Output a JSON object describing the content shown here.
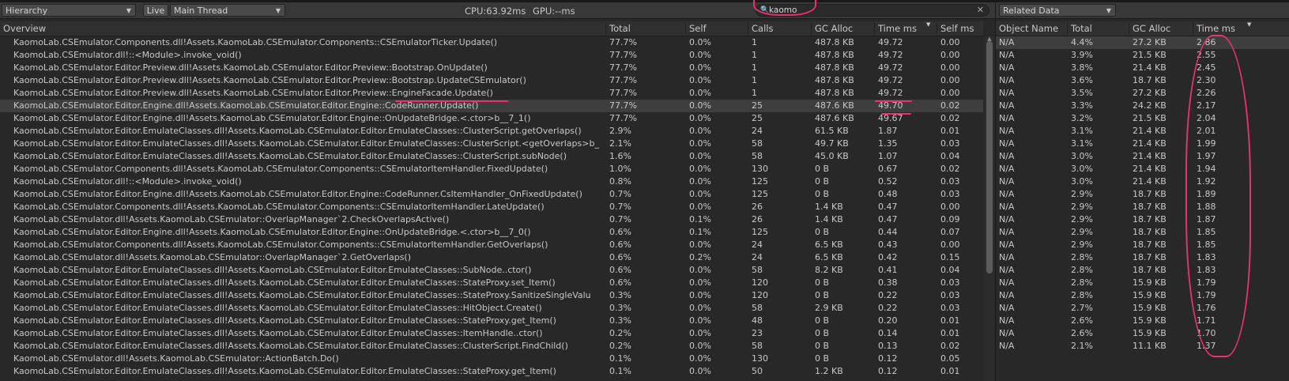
{
  "toolbar": {
    "view_mode": "Hierarchy",
    "live_label": "Live",
    "thread": "Main Thread",
    "cpu": "CPU:63.92ms",
    "gpu": "GPU:--ms",
    "search_value": "kaomo"
  },
  "columns": [
    "Overview",
    "Total",
    "Self",
    "Calls",
    "GC Alloc",
    "Time ms",
    "Self ms"
  ],
  "rows": [
    {
      "name": "KaomoLab.CSEmulator.Components.dll!Assets.KaomoLab.CSEmulator.Components::CSEmulatorTicker.Update()",
      "total": "77.7%",
      "self": "0.0%",
      "calls": "1",
      "gc": "487.8 KB",
      "time": "49.72",
      "selfms": "0.00"
    },
    {
      "name": "KaomoLab.CSEmulator.dll!::<Module>.invoke_void()",
      "total": "77.7%",
      "self": "0.0%",
      "calls": "1",
      "gc": "487.8 KB",
      "time": "49.72",
      "selfms": "0.00"
    },
    {
      "name": "KaomoLab.CSEmulator.Editor.Preview.dll!Assets.KaomoLab.CSEmulator.Editor.Preview::Bootstrap.OnUpdate()",
      "total": "77.7%",
      "self": "0.0%",
      "calls": "1",
      "gc": "487.8 KB",
      "time": "49.72",
      "selfms": "0.00"
    },
    {
      "name": "KaomoLab.CSEmulator.Editor.Preview.dll!Assets.KaomoLab.CSEmulator.Editor.Preview::Bootstrap.UpdateCSEmulator()",
      "total": "77.7%",
      "self": "0.0%",
      "calls": "1",
      "gc": "487.8 KB",
      "time": "49.72",
      "selfms": "0.00"
    },
    {
      "name": "KaomoLab.CSEmulator.Editor.Preview.dll!Assets.KaomoLab.CSEmulator.Editor.Preview::EngineFacade.Update()",
      "total": "77.7%",
      "self": "0.0%",
      "calls": "1",
      "gc": "487.8 KB",
      "time": "49.72",
      "selfms": "0.00"
    },
    {
      "name": "KaomoLab.CSEmulator.Editor.Engine.dll!Assets.KaomoLab.CSEmulator.Editor.Engine::CodeRunner.Update()",
      "total": "77.7%",
      "self": "0.0%",
      "calls": "25",
      "gc": "487.6 KB",
      "time": "49.70",
      "selfms": "0.02"
    },
    {
      "name": "KaomoLab.CSEmulator.Editor.Engine.dll!Assets.KaomoLab.CSEmulator.Editor.Engine::OnUpdateBridge.<.ctor>b__7_1()",
      "total": "77.7%",
      "self": "0.0%",
      "calls": "25",
      "gc": "487.6 KB",
      "time": "49.67",
      "selfms": "0.02"
    },
    {
      "name": "KaomoLab.CSEmulator.Editor.EmulateClasses.dll!Assets.KaomoLab.CSEmulator.Editor.EmulateClasses::ClusterScript.getOverlaps()",
      "total": "2.9%",
      "self": "0.0%",
      "calls": "24",
      "gc": "61.5 KB",
      "time": "1.87",
      "selfms": "0.01"
    },
    {
      "name": "KaomoLab.CSEmulator.Editor.EmulateClasses.dll!Assets.KaomoLab.CSEmulator.Editor.EmulateClasses::ClusterScript.<getOverlaps>b_",
      "total": "2.1%",
      "self": "0.0%",
      "calls": "58",
      "gc": "49.7 KB",
      "time": "1.35",
      "selfms": "0.03"
    },
    {
      "name": "KaomoLab.CSEmulator.Editor.EmulateClasses.dll!Assets.KaomoLab.CSEmulator.Editor.EmulateClasses::ClusterScript.subNode()",
      "total": "1.6%",
      "self": "0.0%",
      "calls": "58",
      "gc": "45.0 KB",
      "time": "1.07",
      "selfms": "0.04"
    },
    {
      "name": "KaomoLab.CSEmulator.Components.dll!Assets.KaomoLab.CSEmulator.Components::CSEmulatorItemHandler.FixedUpdate()",
      "total": "1.0%",
      "self": "0.0%",
      "calls": "130",
      "gc": "0 B",
      "time": "0.67",
      "selfms": "0.02"
    },
    {
      "name": "KaomoLab.CSEmulator.dll!::<Module>.invoke_void()",
      "total": "0.8%",
      "self": "0.0%",
      "calls": "125",
      "gc": "0 B",
      "time": "0.52",
      "selfms": "0.03"
    },
    {
      "name": "KaomoLab.CSEmulator.Editor.Engine.dll!Assets.KaomoLab.CSEmulator.Editor.Engine::CodeRunner.CsItemHandler_OnFixedUpdate()",
      "total": "0.7%",
      "self": "0.0%",
      "calls": "125",
      "gc": "0 B",
      "time": "0.48",
      "selfms": "0.03"
    },
    {
      "name": "KaomoLab.CSEmulator.Components.dll!Assets.KaomoLab.CSEmulator.Components::CSEmulatorItemHandler.LateUpdate()",
      "total": "0.7%",
      "self": "0.0%",
      "calls": "26",
      "gc": "1.4 KB",
      "time": "0.47",
      "selfms": "0.00"
    },
    {
      "name": "KaomoLab.CSEmulator.dll!Assets.KaomoLab.CSEmulator::OverlapManager`2.CheckOverlapsActive()",
      "total": "0.7%",
      "self": "0.1%",
      "calls": "26",
      "gc": "1.4 KB",
      "time": "0.47",
      "selfms": "0.09"
    },
    {
      "name": "KaomoLab.CSEmulator.Editor.Engine.dll!Assets.KaomoLab.CSEmulator.Editor.Engine::OnUpdateBridge.<.ctor>b__7_0()",
      "total": "0.6%",
      "self": "0.1%",
      "calls": "125",
      "gc": "0 B",
      "time": "0.44",
      "selfms": "0.07"
    },
    {
      "name": "KaomoLab.CSEmulator.Components.dll!Assets.KaomoLab.CSEmulator.Components::CSEmulatorItemHandler.GetOverlaps()",
      "total": "0.6%",
      "self": "0.0%",
      "calls": "24",
      "gc": "6.5 KB",
      "time": "0.43",
      "selfms": "0.00"
    },
    {
      "name": "KaomoLab.CSEmulator.dll!Assets.KaomoLab.CSEmulator::OverlapManager`2.GetOverlaps()",
      "total": "0.6%",
      "self": "0.2%",
      "calls": "24",
      "gc": "6.5 KB",
      "time": "0.42",
      "selfms": "0.15"
    },
    {
      "name": "KaomoLab.CSEmulator.Editor.EmulateClasses.dll!Assets.KaomoLab.CSEmulator.Editor.EmulateClasses::SubNode..ctor()",
      "total": "0.6%",
      "self": "0.0%",
      "calls": "58",
      "gc": "8.2 KB",
      "time": "0.41",
      "selfms": "0.04"
    },
    {
      "name": "KaomoLab.CSEmulator.Editor.EmulateClasses.dll!Assets.KaomoLab.CSEmulator.Editor.EmulateClasses::StateProxy.set_Item()",
      "total": "0.6%",
      "self": "0.0%",
      "calls": "120",
      "gc": "0 B",
      "time": "0.38",
      "selfms": "0.03"
    },
    {
      "name": "KaomoLab.CSEmulator.Editor.EmulateClasses.dll!Assets.KaomoLab.CSEmulator.Editor.EmulateClasses::StateProxy.SanitizeSingleValu",
      "total": "0.3%",
      "self": "0.0%",
      "calls": "120",
      "gc": "0 B",
      "time": "0.22",
      "selfms": "0.03"
    },
    {
      "name": "KaomoLab.CSEmulator.Editor.EmulateClasses.dll!Assets.KaomoLab.CSEmulator.Editor.EmulateClasses::HitObject.Create()",
      "total": "0.3%",
      "self": "0.0%",
      "calls": "58",
      "gc": "2.9 KB",
      "time": "0.22",
      "selfms": "0.03"
    },
    {
      "name": "KaomoLab.CSEmulator.Editor.EmulateClasses.dll!Assets.KaomoLab.CSEmulator.Editor.EmulateClasses::StateProxy.get_Item()",
      "total": "0.3%",
      "self": "0.0%",
      "calls": "48",
      "gc": "0 B",
      "time": "0.20",
      "selfms": "0.01"
    },
    {
      "name": "KaomoLab.CSEmulator.Editor.EmulateClasses.dll!Assets.KaomoLab.CSEmulator.Editor.EmulateClasses::ItemHandle..ctor()",
      "total": "0.2%",
      "self": "0.0%",
      "calls": "23",
      "gc": "0 B",
      "time": "0.14",
      "selfms": "0.01"
    },
    {
      "name": "KaomoLab.CSEmulator.Editor.EmulateClasses.dll!Assets.KaomoLab.CSEmulator.Editor.EmulateClasses::ClusterScript.FindChild()",
      "total": "0.2%",
      "self": "0.0%",
      "calls": "58",
      "gc": "0 B",
      "time": "0.13",
      "selfms": "0.02"
    },
    {
      "name": "KaomoLab.CSEmulator.dll!Assets.KaomoLab.CSEmulator::ActionBatch.Do()",
      "total": "0.1%",
      "self": "0.0%",
      "calls": "130",
      "gc": "0 B",
      "time": "0.12",
      "selfms": "0.05"
    },
    {
      "name": "KaomoLab.CSEmulator.Editor.EmulateClasses.dll!Assets.KaomoLab.CSEmulator.Editor.EmulateClasses::StateProxy.get_Item()",
      "total": "0.1%",
      "self": "0.0%",
      "calls": "50",
      "gc": "1.2 KB",
      "time": "0.12",
      "selfms": "0.01"
    }
  ],
  "selected_row": 5,
  "related": {
    "title": "Related Data",
    "columns": [
      "Object Name",
      "Total",
      "GC Alloc",
      "Time ms"
    ],
    "rows": [
      {
        "name": "N/A",
        "total": "4.4%",
        "gc": "27.2 KB",
        "time": "2.86"
      },
      {
        "name": "N/A",
        "total": "3.9%",
        "gc": "21.5 KB",
        "time": "2.55"
      },
      {
        "name": "N/A",
        "total": "3.8%",
        "gc": "21.4 KB",
        "time": "2.45"
      },
      {
        "name": "N/A",
        "total": "3.6%",
        "gc": "18.7 KB",
        "time": "2.30"
      },
      {
        "name": "N/A",
        "total": "3.5%",
        "gc": "27.2 KB",
        "time": "2.26"
      },
      {
        "name": "N/A",
        "total": "3.3%",
        "gc": "24.2 KB",
        "time": "2.17"
      },
      {
        "name": "N/A",
        "total": "3.2%",
        "gc": "21.5 KB",
        "time": "2.04"
      },
      {
        "name": "N/A",
        "total": "3.1%",
        "gc": "21.4 KB",
        "time": "2.01"
      },
      {
        "name": "N/A",
        "total": "3.1%",
        "gc": "21.4 KB",
        "time": "1.99"
      },
      {
        "name": "N/A",
        "total": "3.0%",
        "gc": "21.4 KB",
        "time": "1.97"
      },
      {
        "name": "N/A",
        "total": "3.0%",
        "gc": "21.4 KB",
        "time": "1.94"
      },
      {
        "name": "N/A",
        "total": "3.0%",
        "gc": "21.4 KB",
        "time": "1.92"
      },
      {
        "name": "N/A",
        "total": "2.9%",
        "gc": "18.7 KB",
        "time": "1.89"
      },
      {
        "name": "N/A",
        "total": "2.9%",
        "gc": "18.7 KB",
        "time": "1.88"
      },
      {
        "name": "N/A",
        "total": "2.9%",
        "gc": "18.7 KB",
        "time": "1.87"
      },
      {
        "name": "N/A",
        "total": "2.9%",
        "gc": "18.7 KB",
        "time": "1.85"
      },
      {
        "name": "N/A",
        "total": "2.9%",
        "gc": "18.7 KB",
        "time": "1.85"
      },
      {
        "name": "N/A",
        "total": "2.8%",
        "gc": "18.7 KB",
        "time": "1.83"
      },
      {
        "name": "N/A",
        "total": "2.8%",
        "gc": "18.7 KB",
        "time": "1.83"
      },
      {
        "name": "N/A",
        "total": "2.8%",
        "gc": "15.9 KB",
        "time": "1.79"
      },
      {
        "name": "N/A",
        "total": "2.8%",
        "gc": "15.9 KB",
        "time": "1.79"
      },
      {
        "name": "N/A",
        "total": "2.7%",
        "gc": "15.9 KB",
        "time": "1.76"
      },
      {
        "name": "N/A",
        "total": "2.6%",
        "gc": "15.9 KB",
        "time": "1.71"
      },
      {
        "name": "N/A",
        "total": "2.6%",
        "gc": "15.9 KB",
        "time": "1.70"
      },
      {
        "name": "N/A",
        "total": "2.1%",
        "gc": "11.1 KB",
        "time": "1.37"
      }
    ]
  },
  "colors": {
    "background": "#282828",
    "selected_row": "#3e3e3e",
    "annotation": "#e8326c"
  },
  "icons": [
    "dropdown-arrow-icon",
    "sort-desc-icon",
    "search-icon",
    "clear-icon"
  ]
}
